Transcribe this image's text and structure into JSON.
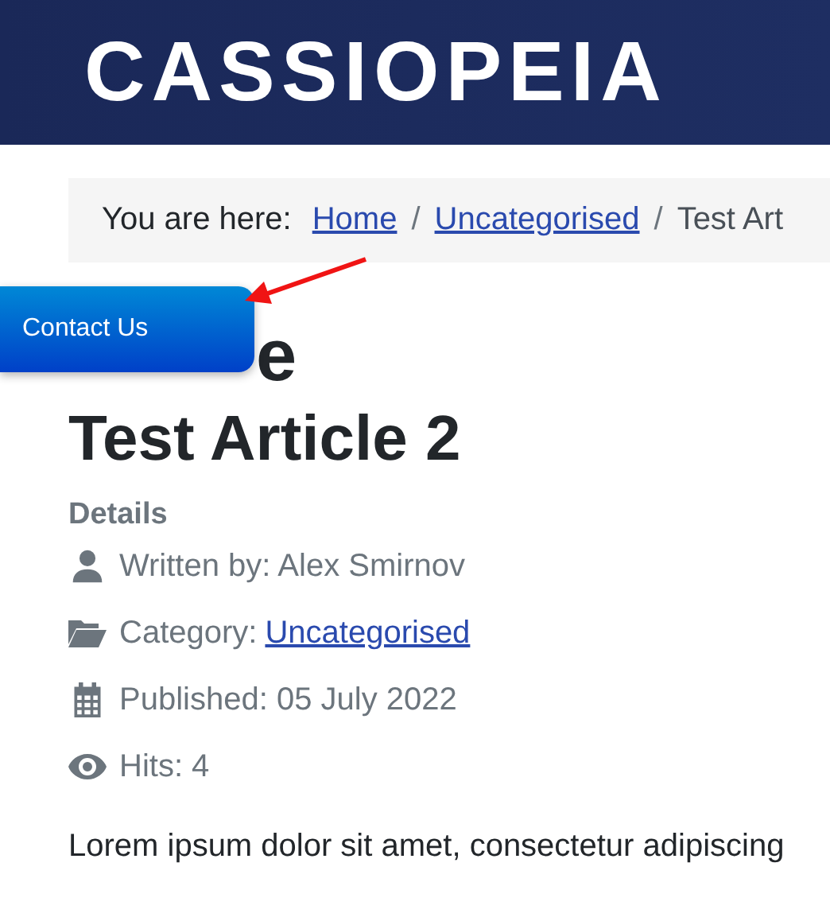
{
  "header": {
    "logo": "CASSIOPEIA"
  },
  "breadcrumb": {
    "label": "You are here:",
    "items": [
      {
        "text": "Home",
        "kind": "link"
      },
      {
        "text": "Uncategorised",
        "kind": "link"
      },
      {
        "text": "Test Art",
        "kind": "current"
      }
    ],
    "separator": "/"
  },
  "contact_button": {
    "label": "Contact Us"
  },
  "page_heading": "e",
  "article": {
    "title": "Test Article 2",
    "details_label": "Details",
    "meta": [
      {
        "kind": "author",
        "text": "Written by: Alex Smirnov"
      },
      {
        "kind": "category",
        "text": "Category: ",
        "link": "Uncategorised"
      },
      {
        "kind": "published",
        "text": "Published: 05 July 2022"
      },
      {
        "kind": "hits",
        "text": "Hits: 4"
      }
    ],
    "body": "Lorem ipsum dolor sit amet, consectetur adipiscing"
  }
}
